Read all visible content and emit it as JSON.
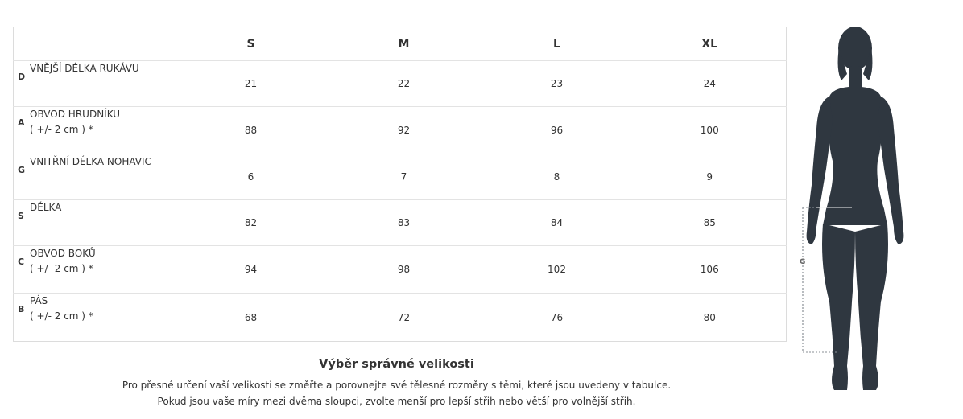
{
  "table": {
    "headers": [
      "S",
      "M",
      "L",
      "XL"
    ],
    "rows": [
      {
        "code": "D",
        "name": "VNĚJŠÍ DÉLKA RUKÁVU",
        "note": "",
        "values": [
          "21",
          "22",
          "23",
          "24"
        ]
      },
      {
        "code": "A",
        "name": "OBVOD HRUDNÍKU",
        "note": "( +/- 2 cm ) *",
        "values": [
          "88",
          "92",
          "96",
          "100"
        ]
      },
      {
        "code": "G",
        "name": "VNITŘNÍ DÉLKA NOHAVIC",
        "note": "",
        "values": [
          "6",
          "7",
          "8",
          "9"
        ]
      },
      {
        "code": "S",
        "name": "DÉLKA",
        "note": "",
        "values": [
          "82",
          "83",
          "84",
          "85"
        ]
      },
      {
        "code": "C",
        "name": "OBVOD BOKŮ",
        "note": "( +/- 2 cm ) *",
        "values": [
          "94",
          "98",
          "102",
          "106"
        ]
      },
      {
        "code": "B",
        "name": "PÁS",
        "note": "( +/- 2 cm ) *",
        "values": [
          "68",
          "72",
          "76",
          "80"
        ]
      }
    ]
  },
  "info": {
    "title": "Výběr správné velikosti",
    "line1": "Pro přesné určení vaší velikosti se změřte a porovnejte své tělesné rozměry s těmi, které jsou uvedeny v tabulce.",
    "line2": "Pokud jsou vaše míry mezi dvěma sloupci, zvolte menší pro lepší střih nebo větší pro volnější střih."
  },
  "figure": {
    "measure_label": "G",
    "silhouette_color": "#2f3740",
    "measure_color": "#8a8f96"
  }
}
